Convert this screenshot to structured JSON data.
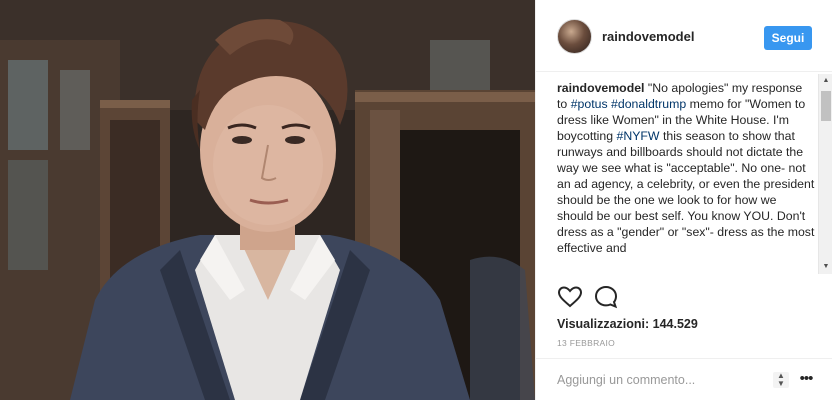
{
  "post": {
    "username": "raindovemodel",
    "follow_label": "Segui",
    "caption": {
      "user": "raindovemodel",
      "p1": " \"No apologies\" my response to ",
      "tag1": "#potus",
      "p2": " ",
      "tag2": "#donaldtrump",
      "p3": " memo for \"Women to dress like Women\" in the White House. I'm boycotting ",
      "tag3": "#NYFW",
      "p4": " this season to show that runways and billboards should not dictate the way we see what is \"acceptable\". No one- not an ad agency, a celebrity, or even the president should be the one we look to for how we should be our best self. You know YOU. Don't dress as a \"gender\" or \"sex\"- dress as the most effective and"
    },
    "views": "Visualizzazioni: 144.529",
    "date": "13 FEBBRAIO",
    "comment_placeholder": "Aggiungi un commento...",
    "icons": {
      "like": "heart-icon",
      "comment": "comment-bubble-icon",
      "more": "more-options-icon"
    }
  },
  "colors": {
    "follow_button": "#3897f0",
    "hashtag": "#003569",
    "muted_text": "#999999"
  }
}
